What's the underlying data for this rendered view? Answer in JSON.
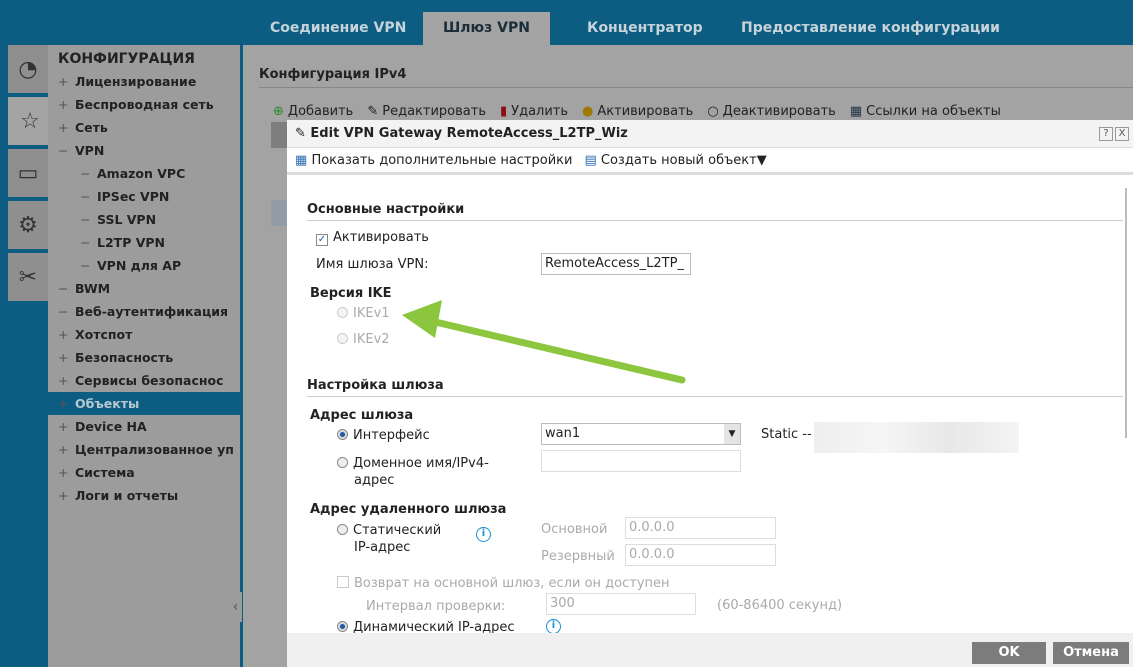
{
  "tabs": [
    {
      "label": "Соединение VPN"
    },
    {
      "label": "Шлюз VPN",
      "active": true
    },
    {
      "label": "Концентратор"
    },
    {
      "label": "Предоставление конфигурации"
    }
  ],
  "icons": [
    "dashboard-icon",
    "configuration-wand-icon",
    "monitor-icon",
    "gear-icon",
    "maintenance-tools-icon"
  ],
  "sidebar": {
    "title": "КОНФИГУРАЦИЯ",
    "items": [
      {
        "label": "Лицензирование",
        "mark": "+"
      },
      {
        "label": "Беспроводная сеть",
        "mark": "+"
      },
      {
        "label": "Сеть",
        "mark": "+"
      },
      {
        "label": "VPN",
        "mark": "−"
      },
      {
        "label": "Amazon VPC",
        "mark": "−",
        "sub": true
      },
      {
        "label": "IPSec VPN",
        "mark": "−",
        "sub": true
      },
      {
        "label": "SSL VPN",
        "mark": "−",
        "sub": true
      },
      {
        "label": "L2TP VPN",
        "mark": "−",
        "sub": true
      },
      {
        "label": "VPN для AP",
        "mark": "−",
        "sub": true
      },
      {
        "label": "BWM",
        "mark": "−"
      },
      {
        "label": "Веб-аутентификация",
        "mark": "−"
      },
      {
        "label": "Хотспот",
        "mark": "+"
      },
      {
        "label": "Безопасность",
        "mark": "+"
      },
      {
        "label": "Сервисы безопаснос",
        "mark": "+"
      },
      {
        "label": "Объекты",
        "mark": "+",
        "selected": true
      },
      {
        "label": "Device HA",
        "mark": "+"
      },
      {
        "label": "Централизованное уп",
        "mark": "+"
      },
      {
        "label": "Система",
        "mark": "+"
      },
      {
        "label": "Логи и отчеты",
        "mark": "+"
      }
    ]
  },
  "main": {
    "title": "Конфигурация IPv4",
    "toolbar": [
      "Добавить",
      "Редактировать",
      "Удалить",
      "Активировать",
      "Деактивировать",
      "Ссылки на объекты"
    ]
  },
  "dialog": {
    "title": "Edit VPN Gateway RemoteAccess_L2TP_Wiz",
    "help": "?",
    "close": "X",
    "toolbar": {
      "advanced": "Показать дополнительные настройки",
      "create": "Создать новый объект"
    },
    "basic": {
      "section": "Основные настройки",
      "activate": "Активировать",
      "activate_checked": true,
      "name_label": "Имя шлюза VPN:",
      "name_value": "RemoteAccess_L2TP_"
    },
    "ike": {
      "label": "Версия IKE",
      "v1": "IKEv1",
      "v2": "IKEv2",
      "selected": "IKEv1"
    },
    "gateway": {
      "section": "Настройка шлюза",
      "addr_label": "Адрес шлюза",
      "interface": "Интерфейс",
      "interface_value": "wan1",
      "static_label": "Static --",
      "domain": "Доменное имя/IPv4-",
      "domain2": "адрес",
      "selected": "Интерфейс"
    },
    "remote": {
      "label": "Адрес удаленного шлюза",
      "static": "Статический",
      "static2": "IP-адрес",
      "primary_label": "Основной",
      "primary_value": "0.0.0.0",
      "backup_label": "Резервный",
      "backup_value": "0.0.0.0",
      "fallback": "Возврат на основной шлюз, если он доступен",
      "interval_label": "Интервал проверки:",
      "interval_value": "300",
      "interval_hint": "(60-86400 секунд)",
      "dynamic": "Динамический IP-адрес",
      "selected": "Динамический IP-адрес"
    },
    "ok": "OK",
    "cancel": "Отмена"
  },
  "colors": {
    "accent_blue": "#0d5c82",
    "arrow": "#8cc63f",
    "info": "#1a8fd0"
  }
}
